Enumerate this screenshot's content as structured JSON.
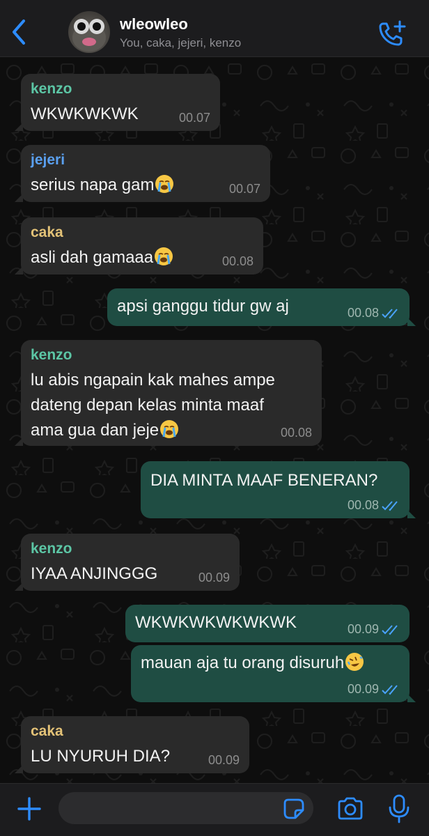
{
  "header": {
    "group_name": "wleowleo",
    "members": "You, caka, jejeri, kenzo"
  },
  "colors": {
    "accent": "#2d8cff",
    "incoming_bubble": "#2a2a2a",
    "outgoing_bubble": "#1f4d43",
    "kenzo": "#5cc6a5",
    "jejeri": "#5aa0f0",
    "caka": "#e3c277"
  },
  "messages": [
    {
      "sender": "kenzo",
      "text": "WKWKWKWK",
      "time": "00.07"
    },
    {
      "sender": "jejeri",
      "text": "serius napa gam",
      "emoji": "loudly-crying-face",
      "time": "00.07"
    },
    {
      "sender": "caka",
      "text": "asli dah gamaaa",
      "emoji": "loudly-crying-face",
      "time": "00.08"
    },
    {
      "text": "apsi ganggu tidur gw aj",
      "time": "00.08"
    },
    {
      "sender": "kenzo",
      "text": "lu abis ngapain kak mahes ampe\ndateng depan kelas minta maaf\nama gua dan jeje",
      "emoji": "loudly-crying-face",
      "time": "00.08"
    },
    {
      "text": "DIA MINTA MAAF BENERAN?",
      "time": "00.08"
    },
    {
      "sender": "kenzo",
      "text": "IYAA ANJINGGG",
      "time": "00.09"
    },
    {
      "text": "WKWKWKWKWKWK",
      "time": "00.09"
    },
    {
      "text": "mauan aja tu orang disuruh",
      "emoji": "rolling-on-floor-laughing",
      "time": "00.09"
    },
    {
      "sender": "caka",
      "text": "LU NYURUH DIA?",
      "time": "00.09"
    }
  ],
  "input": {
    "placeholder": ""
  }
}
